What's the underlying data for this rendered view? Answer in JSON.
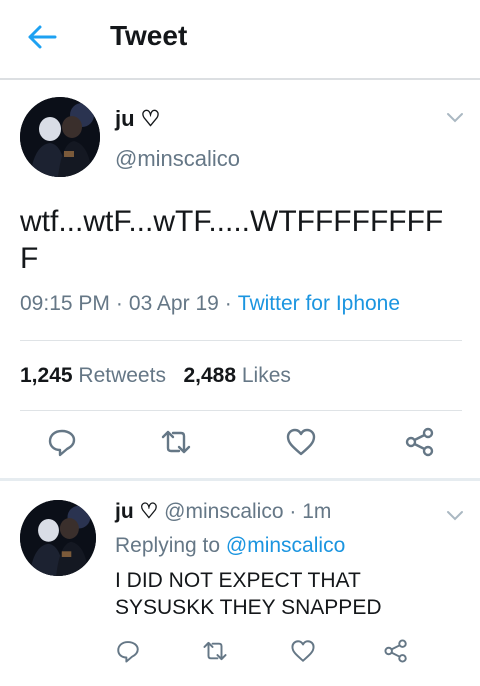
{
  "header": {
    "title": "Tweet",
    "back_icon": "arrow-left-icon"
  },
  "tweet": {
    "author_name": "ju ♡",
    "author_handle": "@minscalico",
    "text": "wtf...wtF...wTF.....WTFFFFFFFF F",
    "time": "09:15 PM",
    "date": "03 Apr 19",
    "client": "Twitter for Iphone",
    "retweets_count": "1,245",
    "retweets_label": "Retweets",
    "likes_count": "2,488",
    "likes_label": "Likes"
  },
  "reply": {
    "author_name": "ju ♡",
    "author_handle": "@minscalico",
    "age": "1m",
    "replying_prefix": "Replying to",
    "replying_to": "@minscalico",
    "text": "I DID NOT EXPECT THAT SYSUSKK THEY SNAPPED"
  },
  "actions": [
    "reply-icon",
    "retweet-icon",
    "heart-icon",
    "share-icon"
  ],
  "colors": {
    "accent": "#1b95e0",
    "muted": "#657786",
    "text": "#14171a",
    "divider": "#dfe3e6"
  }
}
